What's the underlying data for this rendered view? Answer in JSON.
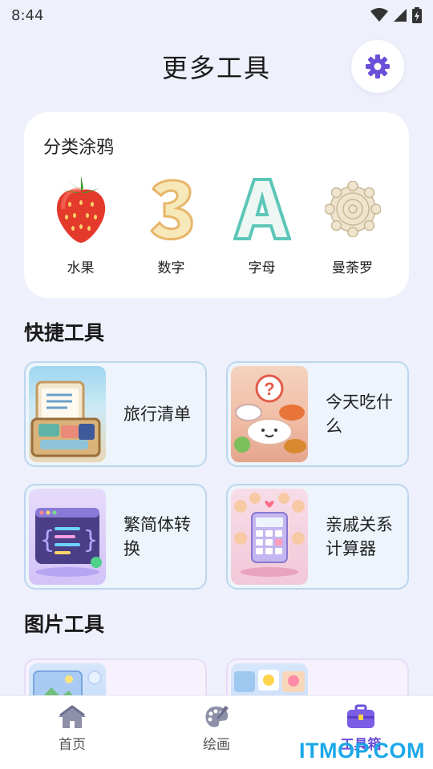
{
  "status_bar": {
    "time": "8:44"
  },
  "header": {
    "title": "更多工具"
  },
  "doodle": {
    "title": "分类涂鸦",
    "items": [
      {
        "label": "水果",
        "icon": "strawberry-icon"
      },
      {
        "label": "数字",
        "icon": "number-3-icon"
      },
      {
        "label": "字母",
        "icon": "letter-a-icon"
      },
      {
        "label": "曼荼罗",
        "icon": "mandala-icon"
      }
    ]
  },
  "quick_tools": {
    "title": "快捷工具",
    "items": [
      {
        "label": "旅行清单",
        "icon": "suitcase-icon"
      },
      {
        "label": "今天吃什么",
        "icon": "food-plate-icon"
      },
      {
        "label": "繁简体转换",
        "icon": "code-window-icon"
      },
      {
        "label": "亲戚关系计算器",
        "icon": "calculator-icon"
      }
    ]
  },
  "image_tools": {
    "title": "图片工具"
  },
  "bottom_nav": {
    "items": [
      {
        "label": "首页",
        "icon": "home-icon"
      },
      {
        "label": "绘画",
        "icon": "palette-icon"
      },
      {
        "label": "工具箱",
        "icon": "toolbox-icon"
      }
    ],
    "active_index": 2
  },
  "watermark": "ITMOP.COM",
  "colors": {
    "accent": "#6a4fd8",
    "background": "#eef0fb",
    "watermark": "#1aa8e8"
  }
}
